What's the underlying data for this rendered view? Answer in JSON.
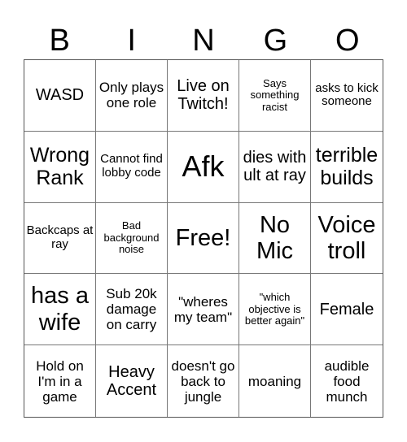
{
  "header": {
    "letters": [
      "B",
      "I",
      "N",
      "G",
      "O"
    ]
  },
  "board": {
    "cells": [
      [
        "WASD",
        "Only plays one role",
        "Live on Twitch!",
        "Says something racist",
        "asks to kick someone"
      ],
      [
        "Wrong Rank",
        "Cannot find lobby code",
        "Afk",
        "dies with ult at ray",
        "terrible builds"
      ],
      [
        "Backcaps at ray",
        "Bad background noise",
        "Free!",
        "No Mic",
        "Voice troll"
      ],
      [
        "has a wife",
        "Sub 20k damage on carry",
        "\"wheres my team\"",
        "\"which objective is better again\"",
        "Female"
      ],
      [
        "Hold on I'm in a game",
        "Heavy Accent",
        "doesn't go back to jungle",
        "moaning",
        "audible food munch"
      ]
    ],
    "free_space": {
      "row": 2,
      "col": 2
    }
  }
}
